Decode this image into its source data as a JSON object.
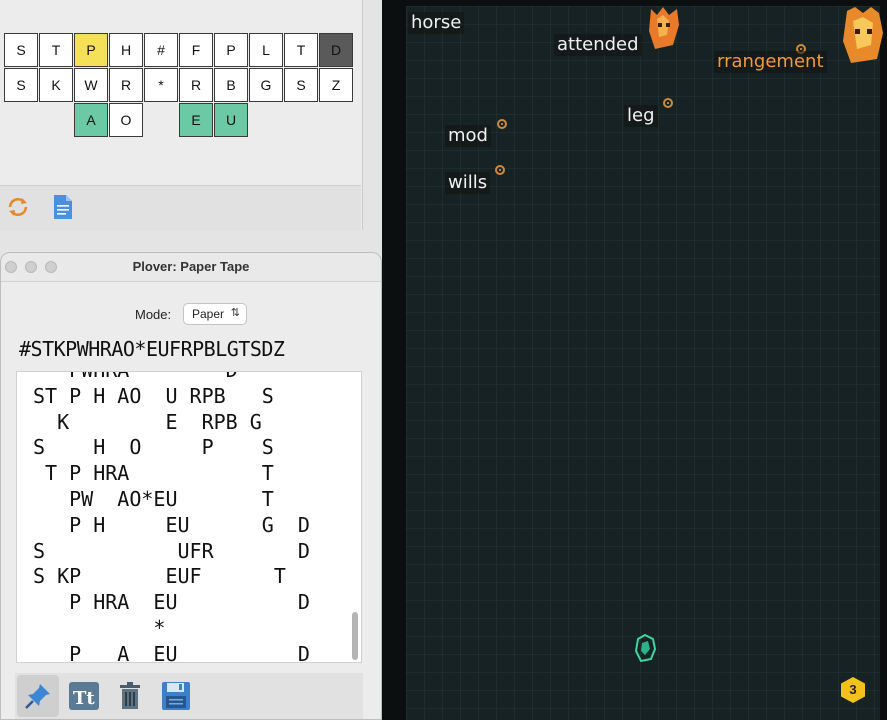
{
  "steno_layout": {
    "rows": [
      [
        "S",
        "T",
        "P",
        "H",
        "#",
        "F",
        "P",
        "L",
        "T",
        "D"
      ],
      [
        "S",
        "K",
        "W",
        "R",
        "*",
        "R",
        "B",
        "G",
        "S",
        "Z"
      ]
    ],
    "vowels_left": [
      "A",
      "O"
    ],
    "vowels_right": [
      "E",
      "U"
    ],
    "highlighted_yellow": [
      "P"
    ],
    "highlighted_dark": [
      "D"
    ],
    "toolbar_icons": [
      "refresh-icon",
      "document-icon"
    ]
  },
  "paper_tape": {
    "title": "Plover: Paper Tape",
    "mode_label": "Mode:",
    "mode_value": "Paper",
    "mode_caret": "⌃",
    "header_keys": "#STKPWHRAO*EUFRPBLGTSDZ",
    "lines": [
      "   PWHRA        D  ",
      "ST P H AO  U RPB   S",
      "  K        E  RPB G  ",
      "S    H  O     P    S",
      " T P HRA           T",
      "   PW  AO*EU       T",
      "   P H     EU      G  D",
      "S           UFR       D",
      "S KP       EUF      T",
      "   P HRA  EU          D",
      "          *",
      "   P   A  EU          D"
    ],
    "toolbar_icons": [
      "pin-icon",
      "font-icon",
      "trash-icon",
      "save-icon"
    ],
    "toolbar_text_icon": "Tt"
  },
  "game": {
    "words": [
      {
        "text": "horse"
      },
      {
        "text": "attended"
      },
      {
        "text": "rrangement"
      },
      {
        "text": "leg"
      },
      {
        "text": "mod"
      },
      {
        "text": "wills"
      }
    ],
    "score_badge": "3",
    "colors": {
      "background": "#162223",
      "text": "#f1f1f1",
      "enemy": "#d08a3a",
      "player": "#3fd6a0",
      "badge": "#f2c21a"
    }
  }
}
